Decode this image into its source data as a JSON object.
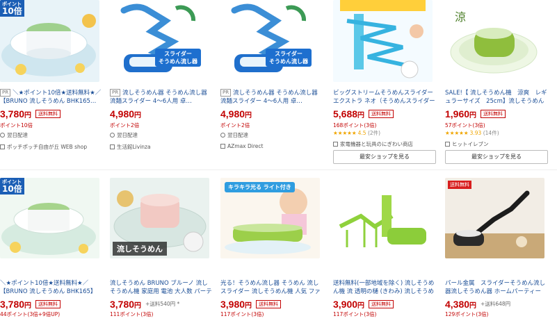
{
  "products_row1": [
    {
      "pr": "PR",
      "title": "＼★ポイント10倍★送料無料★／【BRUNO 流しそうめん BHK165…",
      "price": "3,780",
      "yen": "円",
      "badge": "送料無料",
      "points": "ポイント10倍",
      "meta1": "翌日配達",
      "meta2": "ポッチポッチ自由が丘 WEB shop",
      "ribbon_top": "ポイント",
      "ribbon_big": "10倍"
    },
    {
      "pr": "PR",
      "title": "流しそうめん器 そうめん流し器 流麺スライダー 4～6人用 卓…",
      "price": "4,980",
      "yen": "円",
      "points": "ポイント2倍",
      "meta1": "翌日配達",
      "meta2": "生活館Livinza",
      "img_tag1": "スライダー",
      "img_tag2": "そうめん流し器"
    },
    {
      "pr": "PR",
      "title": "流しそうめん器 そうめん流し器 流麺スライダー 4～6人用 卓…",
      "price": "4,980",
      "yen": "円",
      "points": "ポイント2倍",
      "meta1": "翌日配達",
      "meta2": "AZmax Direct",
      "img_tag1": "スライダー",
      "img_tag2": "そうめん流し器"
    },
    {
      "title": "ビッグストリームそうめんスライダーエクストラ ネオ（そうめんスライダーシリーズ",
      "price": "5,688",
      "yen": "円",
      "badge": "送料無料",
      "points": "168ポイント(3倍)",
      "rating_stars": "★★★★★",
      "rating_num": "4.5",
      "rating_count": "(2件)",
      "meta2": "家電機器と玩具のにぎわい商店",
      "shop_button": "最安ショップを見る"
    },
    {
      "title": "SALE!【 流しそうめん機　涼爽　レギュラーサイズ　25cm】流しそうめん器　電池",
      "price": "1,960",
      "yen": "円",
      "badge": "送料無料",
      "points": "57ポイント(3倍)",
      "rating_stars": "★★★★★",
      "rating_num": "3.93",
      "rating_count": "(14件)",
      "meta2": "ヒットイレブン",
      "shop_button": "最安ショップを見る",
      "img_tag1": "涼"
    }
  ],
  "products_row2": [
    {
      "title": "＼★ポイント10倍★送料無料★／【BRUNO 流しそうめん BHK165】【ブ",
      "price": "3,780",
      "yen": "円",
      "badge": "送料無料",
      "points": "44ポイント(3倍+9倍UP)",
      "ribbon_top": "ポイント",
      "ribbon_big": "10倍"
    },
    {
      "title": "流しそうめん BRUNO ブルーノ 流しそうめん機 家庭用 電池 大人数 パーティー そうめ",
      "price": "3,780",
      "yen": "円",
      "plus": "+送料540円 *",
      "points": "111ポイント(3倍)",
      "img_tag1": "流しそうめん",
      "brand": "BRUNO"
    },
    {
      "title": "光る！そうめん流し器 そうめん 流し スライダー 流しそうめん機 人気 ファミリー 家",
      "price": "3,980",
      "yen": "円",
      "badge": "送料無料",
      "points": "117ポイント(3倍)",
      "img_tag1": "キラキラ光る ライト付き"
    },
    {
      "title": "送料無料(一部地域を除く) 流しそうめん機 流 透明の樋 (きわみ) 流しそうめん器　流",
      "price": "3,900",
      "yen": "円",
      "badge": "送料無料",
      "points": "117ポイント(3倍)"
    },
    {
      "title": "パール金属　スライダーそうめん流し器流しそうめん器 ホームパーティー 電動 卓上",
      "price": "4,380",
      "yen": "円",
      "plus": "+送料648円",
      "points": "129ポイント(3倍)",
      "img_tag1": "送料無料"
    }
  ]
}
